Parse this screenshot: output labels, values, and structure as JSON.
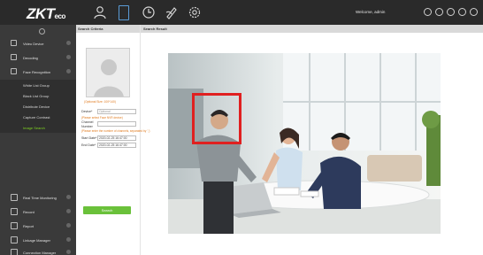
{
  "app": {
    "logo": "ZKT",
    "logo_sub": "eco",
    "welcome": "Welcome, admin",
    "nav_icons": [
      "person-icon",
      "phone-icon",
      "clock-icon",
      "pen-icon",
      "gear-icon"
    ],
    "top_icons": [
      "grid-icon",
      "settings-icon",
      "help-icon",
      "info-icon",
      "power-icon"
    ]
  },
  "sidebar": {
    "items": [
      {
        "label": "Video Device",
        "icon": "video-device-icon"
      },
      {
        "label": "Decoding",
        "icon": "decoding-icon"
      },
      {
        "label": "Face Recognition",
        "icon": "face-recognition-icon"
      }
    ],
    "subitems": [
      {
        "label": "White List Group",
        "active": false
      },
      {
        "label": "Black List Group",
        "active": false
      },
      {
        "label": "Distribute Device",
        "active": false
      },
      {
        "label": "Capture Contrast",
        "active": false
      },
      {
        "label": "Image Search",
        "active": true
      }
    ],
    "bottom_items": [
      {
        "label": "Real Time Monitoring",
        "icon": "monitor-icon"
      },
      {
        "label": "Record",
        "icon": "record-icon"
      },
      {
        "label": "Report",
        "icon": "report-icon"
      },
      {
        "label": "Linkage Manager",
        "icon": "linkage-icon"
      },
      {
        "label": "Connection Manager",
        "icon": "connection-icon"
      }
    ]
  },
  "panel": {
    "criteria_title": "Search Criteria",
    "result_title": "Search Result",
    "photo_hint": "(Optional Size: 100*140)",
    "device_label": "Device*",
    "device_placeholder": "Optional",
    "device_hint": "(Please select Face NVR device)",
    "channel_label": "Channel",
    "number_label": "Number",
    "channel_hint": "(Please enter the number of channels, separated by ',')",
    "start_label": "Start Date*",
    "start_value": "2020-02-25 16:47:00",
    "end_label": "End Date*",
    "end_value": "2020-02-25 16:47:00",
    "search_button": "Search"
  },
  "colors": {
    "topbar": "#2a2a2a",
    "sidebar": "#3a3a3a",
    "accent_green": "#6ac13a",
    "hint_orange": "#e07b1f",
    "face_box": "#e02020"
  }
}
